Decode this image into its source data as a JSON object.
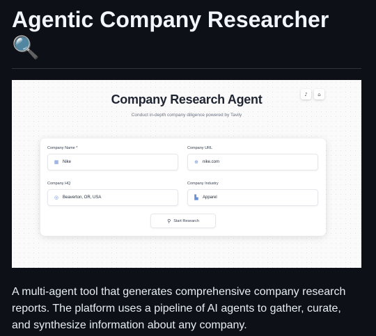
{
  "header": {
    "title": "Agentic Company Researcher",
    "emoji": "🔍"
  },
  "screenshot": {
    "title": "Company Research Agent",
    "subtitle": "Conduct in-depth company diligence powered by Tavily",
    "top_icons": [
      "music-note-icon",
      "github-icon"
    ],
    "form": {
      "company_name": {
        "label": "Company Name *",
        "value": "Nike",
        "icon": "building-icon"
      },
      "company_url": {
        "label": "Company URL",
        "value": "nike.com",
        "icon": "globe-icon"
      },
      "company_hq": {
        "label": "Company HQ",
        "value": "Beaverton, OR, USA",
        "icon": "map-pin-icon"
      },
      "company_industry": {
        "label": "Company Industry",
        "value": "Apparel",
        "icon": "factory-icon"
      },
      "start_button": "Start Research"
    }
  },
  "description": "A multi-agent tool that generates comprehensive company research reports. The platform uses a pipeline of AI agents to gather, curate, and synthesize information about any company."
}
